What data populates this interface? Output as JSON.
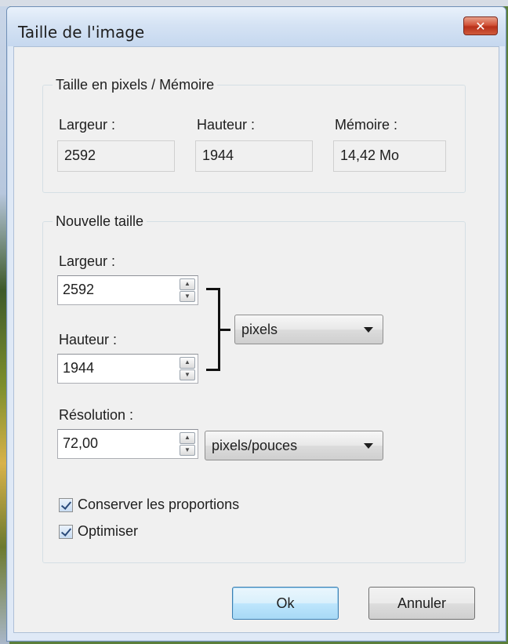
{
  "window": {
    "title": "Taille de l'image",
    "close_icon": "close-icon"
  },
  "pixel_size_group": {
    "legend": "Taille en pixels / Mémoire",
    "width_label": "Largeur :",
    "width_value": "2592",
    "height_label": "Hauteur :",
    "height_value": "1944",
    "memory_label": "Mémoire :",
    "memory_value": "14,42 Mo"
  },
  "new_size_group": {
    "legend": "Nouvelle taille",
    "width_label": "Largeur :",
    "width_value": "2592",
    "height_label": "Hauteur :",
    "height_value": "1944",
    "unit_selected": "pixels",
    "resolution_label": "Résolution :",
    "resolution_value": "72,00",
    "resolution_unit_selected": "pixels/pouces"
  },
  "options": {
    "keep_proportions_label": "Conserver les proportions",
    "keep_proportions_checked": true,
    "optimize_label": "Optimiser",
    "optimize_checked": true
  },
  "buttons": {
    "ok_label": "Ok",
    "cancel_label": "Annuler"
  }
}
